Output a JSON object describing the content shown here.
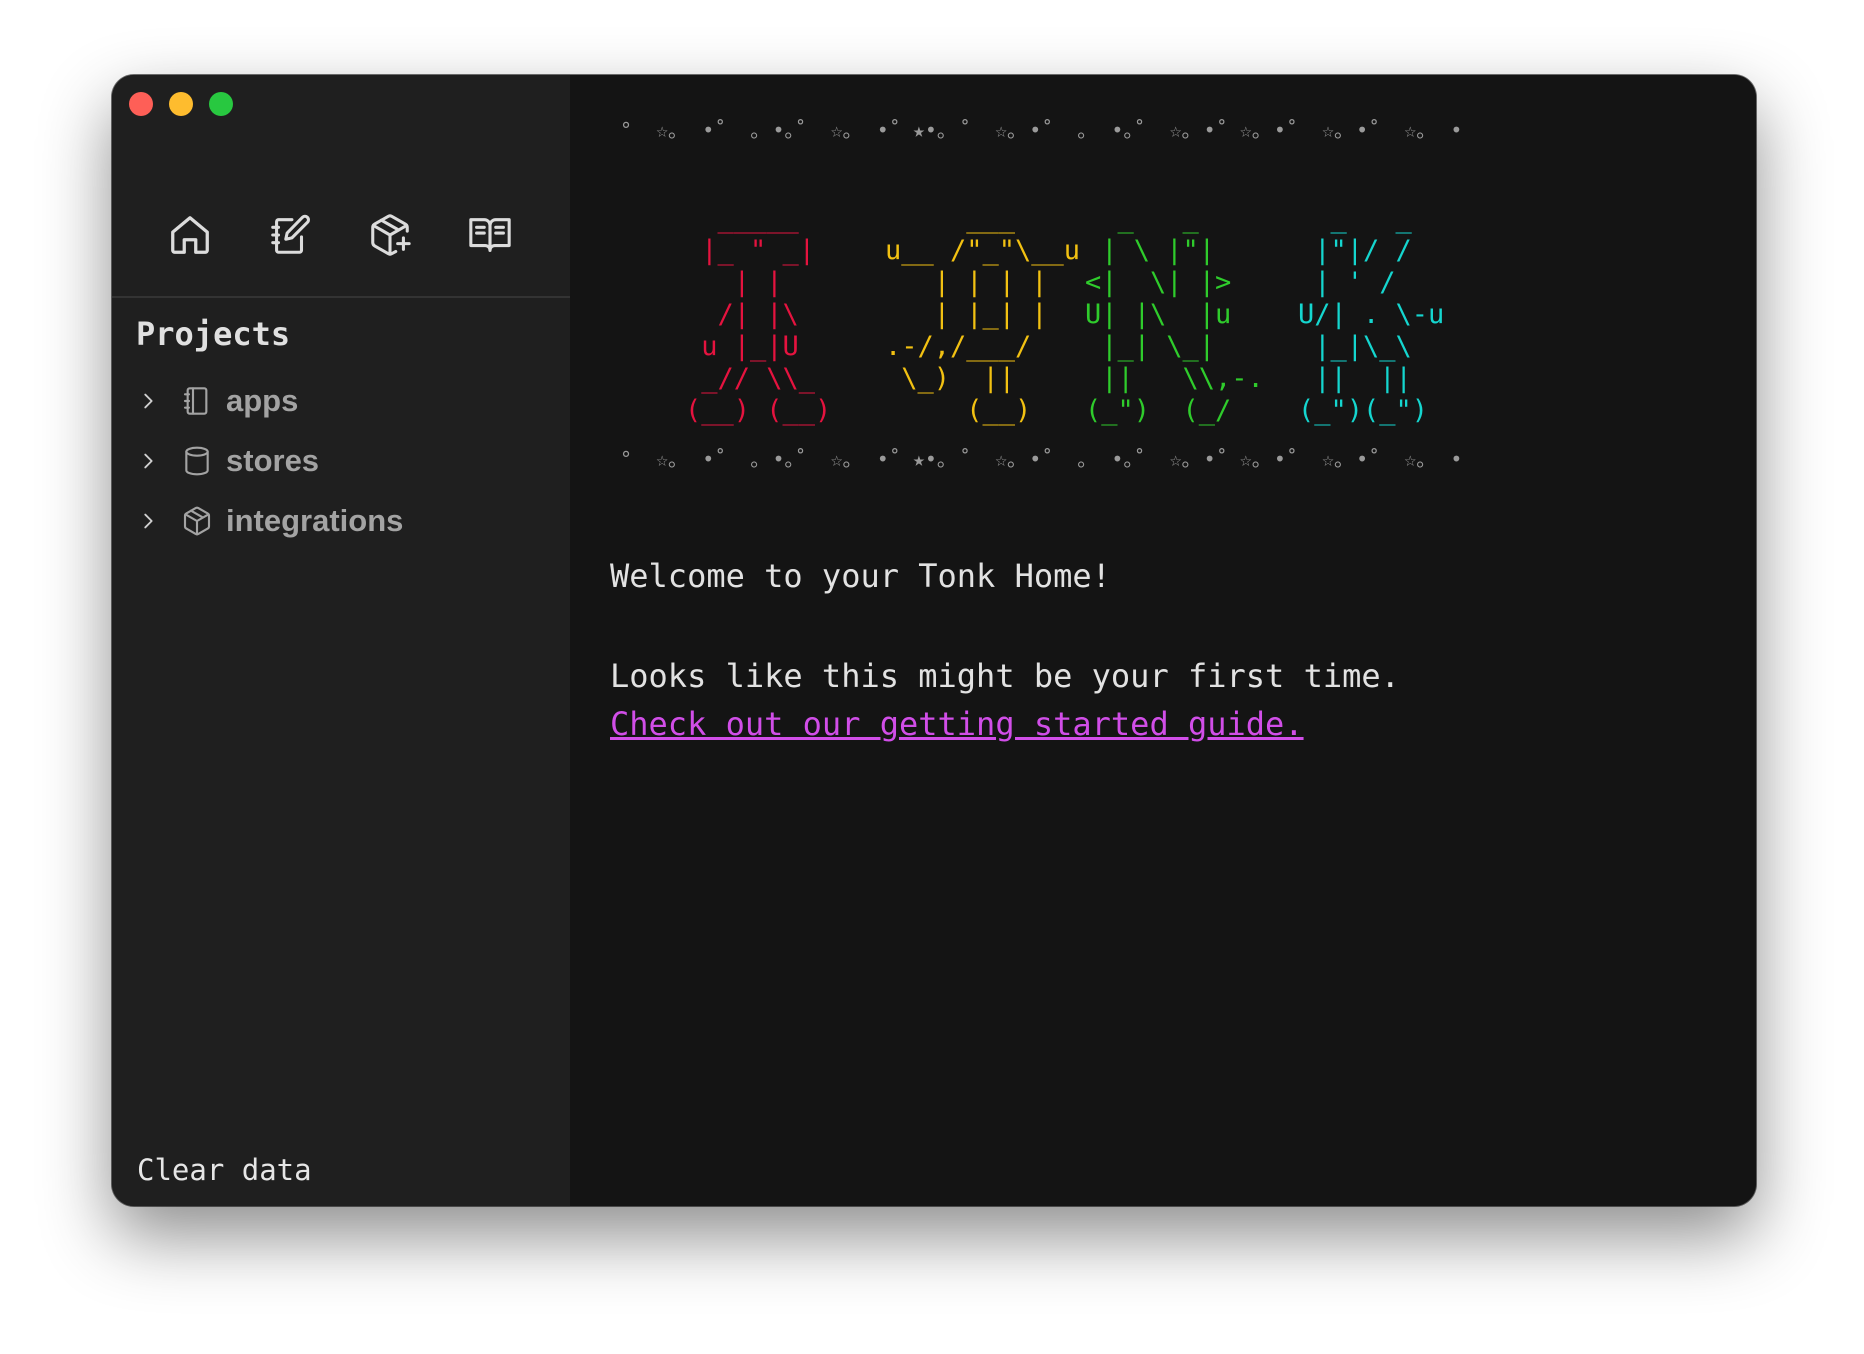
{
  "window": {
    "controls": [
      "close",
      "minimize",
      "zoom"
    ]
  },
  "toolbar": {
    "icons": [
      "home-icon",
      "notebook-edit-icon",
      "package-plus-icon",
      "book-open-icon"
    ]
  },
  "sidebar": {
    "projects_title": "Projects",
    "items": [
      {
        "label": "apps",
        "icon": "notebook-icon"
      },
      {
        "label": "stores",
        "icon": "database-icon"
      },
      {
        "label": "integrations",
        "icon": "package-icon"
      }
    ],
    "clear_data": "Clear data"
  },
  "banner": {
    "stars_row": "°  ☆｡  •˚  ｡ •｡˚  ☆｡  •˚ ★•｡ ˚  ☆｡ •˚  ｡  •｡˚  ☆｡ •˚ ☆｡ •˚  ☆｡ •˚  ☆｡  •",
    "letter_t": "  _____\n |_ \" _|\n   | |\n  /| |\\\n u |_|U\n _// \\\\_\n(__) (__)",
    "letter_o": "     ___\nu__ /\"_\"\\__u\n   | | | |\n   | |_| |\n.-/,/___/\n \\_)  ||\n     (__)",
    "letter_n": "  _   _\n | \\ |\"|\n<|  \\| |>\nU| |\\  |u\n |_| \\_|\n ||   \\\\,-.\n(_\")  (_/",
    "letter_k": "  _   _\n |\"|/ /\n | ' /\nU/| . \\-u\n |_|\\_\\\n ||  ||\n(_\")(_\")",
    "colors": {
      "t": "#e5133f",
      "o": "#f2c112",
      "n": "#2fcc2c",
      "k": "#15d6cf"
    }
  },
  "main": {
    "welcome": "Welcome to your Tonk Home!",
    "first_time": "Looks like this might be your first time.",
    "guide_link": "Check out our getting started guide."
  },
  "theme": {
    "sidebar_bg": "#1f1f1f",
    "main_bg": "#141414",
    "link_color": "#d14ee8"
  }
}
